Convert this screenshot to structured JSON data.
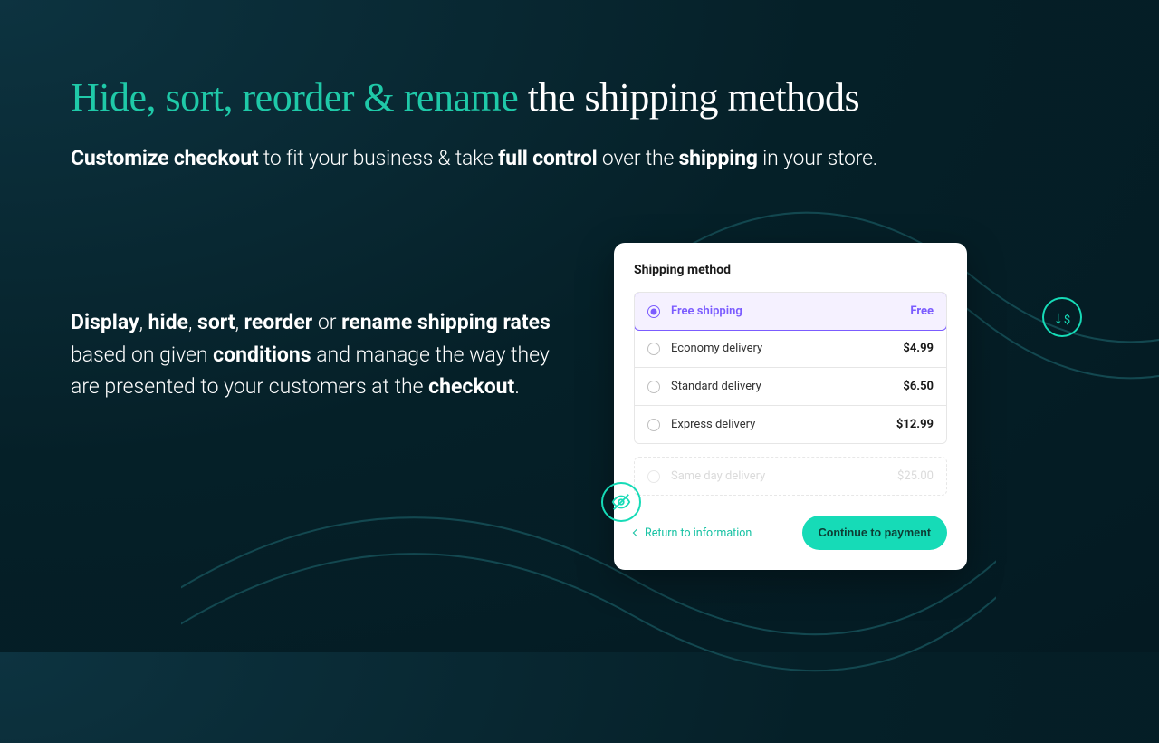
{
  "headline": {
    "teal": "Hide, sort, reorder & rename",
    "rest": " the shipping methods"
  },
  "subhead": {
    "b1": "Customize checkout",
    "t1": " to fit your business & take ",
    "b2": "full control",
    "t2": " over the ",
    "b3": "shipping",
    "t3": " in your store."
  },
  "body": {
    "b1": "Display",
    "s1": ", ",
    "b2": "hide",
    "s2": ", ",
    "b3": "sort",
    "s3": ", ",
    "b4": "reorder",
    "s4": " or ",
    "b5": "rename shipping rates",
    "t1": " based on given ",
    "b6": "conditions",
    "t2": " and manage the way they are presented to your customers at the ",
    "b7": "checkout",
    "t3": "."
  },
  "card": {
    "title": "Shipping method",
    "options": [
      {
        "label": "Free shipping",
        "price": "Free",
        "selected": true
      },
      {
        "label": "Economy delivery",
        "price": "$4.99",
        "selected": false
      },
      {
        "label": "Standard delivery",
        "price": "$6.50",
        "selected": false
      },
      {
        "label": "Express delivery",
        "price": "$12.99",
        "selected": false
      }
    ],
    "hidden": {
      "label": "Same day delivery",
      "price": "$25.00"
    },
    "back_label": "Return to information",
    "cta_label": "Continue to payment"
  }
}
